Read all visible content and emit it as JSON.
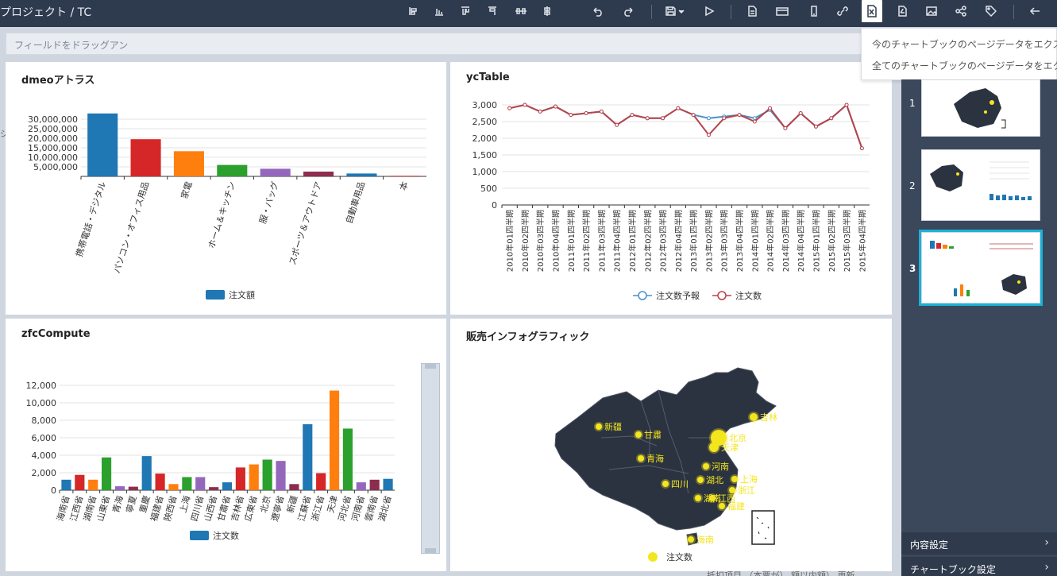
{
  "header": {
    "breadcrumb": "プロジェクト  /  TC"
  },
  "toolbar": {
    "icons": [
      "align-left-icon",
      "bar-chart-icon",
      "align-top-icon",
      "align-right-icon",
      "distribute-icon",
      "distribute-vertical-icon",
      "undo-icon",
      "redo-icon",
      "save-icon",
      "play-icon",
      "document-icon",
      "card-icon",
      "mobile-icon",
      "link-icon",
      "excel-export-icon",
      "pdf-icon",
      "image-icon",
      "share-icon",
      "tag-icon",
      "back-arrow-icon"
    ]
  },
  "dropbar": {
    "placeholder": "フィールドをドラッグアン"
  },
  "export_menu": {
    "items": [
      "今のチャートブックのページデータをエクス",
      "全てのチャートブックのページデータをエク"
    ]
  },
  "sidebar": {
    "pages": [
      {
        "num": "1"
      },
      {
        "num": "2"
      },
      {
        "num": "3"
      }
    ],
    "content_settings": "内容設定",
    "chartbook_settings": "チャートブック設定"
  },
  "bottom_note": "抵扣項目 （本票が） 額以内額）   更新",
  "left_cut": "ジ",
  "panels": {
    "p1": {
      "title": "dmeoアトラス"
    },
    "p2": {
      "title": "ycTable"
    },
    "p3": {
      "title": "zfcCompute"
    },
    "p4": {
      "title": "販売インフォグラフィック",
      "legend": "注文数"
    }
  },
  "chart_data": [
    {
      "type": "bar",
      "title": "dmeoアトラス",
      "categories": [
        "携帯電話・デジタル",
        "パソコン・オフィス用品",
        "家電",
        "ホーム＆キッチン",
        "服・バッグ",
        "スポーツ＆アウトドア",
        "自動車用品",
        "本"
      ],
      "series": [
        {
          "name": "注文額",
          "values": [
            33000000,
            19500000,
            13200000,
            6000000,
            4000000,
            2500000,
            1500000,
            300000
          ]
        }
      ],
      "yticks": [
        "5,000,000",
        "10,000,000",
        "15,000,000",
        "20,000,000",
        "25,000,000",
        "30,000,000"
      ],
      "ylim": [
        0,
        35000000
      ],
      "colors": [
        "#1f77b4",
        "#d62728",
        "#ff7f0e",
        "#2ca02c",
        "#9467bd",
        "#8c2d4f",
        "#1f77b4",
        "#d62728"
      ]
    },
    {
      "type": "line",
      "title": "ycTable",
      "categories": [
        "2010年01四半期",
        "2010年02四半期",
        "2010年03四半期",
        "2010年04四半期",
        "2011年01四半期",
        "2011年02四半期",
        "2011年03四半期",
        "2011年04四半期",
        "2012年01四半期",
        "2012年02四半期",
        "2012年03四半期",
        "2012年04四半期",
        "2013年01四半期",
        "2013年02四半期",
        "2013年03四半期",
        "2013年04四半期",
        "2014年01四半期",
        "2014年02四半期",
        "2014年03四半期",
        "2014年04四半期",
        "2015年01四半期",
        "2015年02四半期",
        "2015年03四半期",
        "2015年04四半期"
      ],
      "series": [
        {
          "name": "注文数予報",
          "values": [
            2900,
            3000,
            2800,
            2950,
            2700,
            2750,
            2800,
            2400,
            2700,
            2600,
            2600,
            2900,
            2700,
            2600,
            2650,
            2700,
            2600,
            2850,
            2300,
            2750,
            2350,
            2600,
            3000,
            1700
          ]
        },
        {
          "name": "注文数",
          "values": [
            2900,
            3000,
            2800,
            2950,
            2700,
            2750,
            2800,
            2400,
            2700,
            2600,
            2600,
            2900,
            2700,
            2100,
            2600,
            2700,
            2500,
            2900,
            2300,
            2750,
            2350,
            2600,
            3000,
            1700
          ]
        }
      ],
      "yticks": [
        "0",
        "500",
        "1,000",
        "1,500",
        "2,000",
        "2,500",
        "3,000"
      ],
      "ylim": [
        0,
        3000
      ],
      "colors": [
        "#4a90c8",
        "#b8434a"
      ]
    },
    {
      "type": "bar",
      "title": "zfcCompute",
      "categories": [
        "海南省",
        "江西省",
        "湖南省",
        "山東省",
        "青海",
        "寧夏",
        "重慶",
        "福建省",
        "陝西省",
        "上海",
        "四川省",
        "山西省",
        "甘肅省",
        "吉林省",
        "広東省",
        "北京",
        "遼寧省",
        "新疆",
        "江蘇省",
        "浙江省",
        "天津",
        "河北省",
        "河南省",
        "雲南省",
        "湖北省"
      ],
      "series": [
        {
          "name": "注文数",
          "values": [
            1200,
            1750,
            1200,
            3750,
            450,
            400,
            3900,
            1900,
            700,
            1500,
            1500,
            350,
            900,
            2600,
            2950,
            3500,
            3350,
            700,
            7550,
            1950,
            11400,
            7050,
            900,
            1200,
            1300
          ]
        }
      ],
      "yticks": [
        "0",
        "2,000",
        "4,000",
        "6,000",
        "8,000",
        "10,000",
        "12,000"
      ],
      "ylim": [
        0,
        12000
      ],
      "colors": [
        "#1f77b4",
        "#d62728",
        "#ff7f0e",
        "#2ca02c",
        "#9467bd",
        "#8c2d4f"
      ]
    },
    {
      "type": "map",
      "title": "販売インフォグラフィック",
      "points": [
        {
          "name": "新疆"
        },
        {
          "name": "甘肅"
        },
        {
          "name": "青海"
        },
        {
          "name": "四川"
        },
        {
          "name": "北京"
        },
        {
          "name": "天津"
        },
        {
          "name": "河南"
        },
        {
          "name": "湖北"
        },
        {
          "name": "上海"
        },
        {
          "name": "浙江"
        },
        {
          "name": "湖南"
        },
        {
          "name": "江西"
        },
        {
          "name": "福建"
        },
        {
          "name": "吉林"
        },
        {
          "name": "海南"
        }
      ]
    }
  ]
}
